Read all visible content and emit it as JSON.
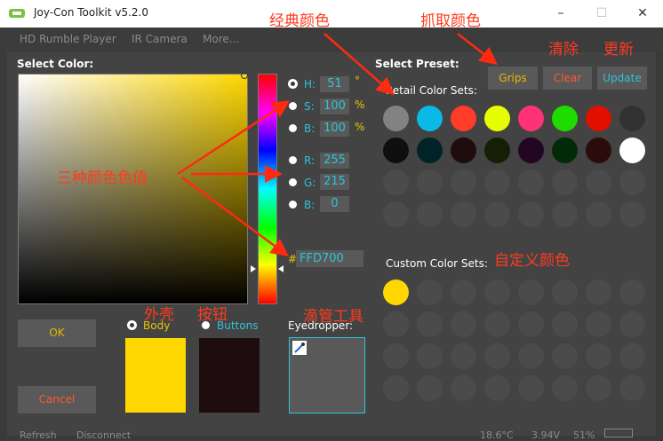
{
  "window": {
    "title": "Joy-Con Toolkit v5.2.0",
    "minimize": "–",
    "maximize": "☐",
    "close": "✕"
  },
  "menu": [
    "HD Rumble Player",
    "IR Camera",
    "More..."
  ],
  "select_color": "Select Color:",
  "hsb": [
    {
      "label": "H:",
      "value": "51",
      "unit": "°",
      "selected": true
    },
    {
      "label": "S:",
      "value": "100",
      "unit": "%"
    },
    {
      "label": "B:",
      "value": "100",
      "unit": "%"
    }
  ],
  "rgb": [
    {
      "label": "R:",
      "value": "255"
    },
    {
      "label": "G:",
      "value": "215"
    },
    {
      "label": "B:",
      "value": "0"
    }
  ],
  "hex": {
    "prefix": "#",
    "value": "FFD700"
  },
  "targets": {
    "body": "Body",
    "buttons": "Buttons",
    "body_color": "#ffd700",
    "buttons_color": "#1e0d0e"
  },
  "ok": "OK",
  "cancel": "Cancel",
  "eyedropper": "Eyedropper:",
  "select_preset": "Select Preset:",
  "buttons": {
    "grips": "Grips",
    "clear": "Clear",
    "update": "Update"
  },
  "retail_sets": "Retail Color Sets:",
  "custom_sets": "Custom Color Sets:",
  "retail_colors": [
    "#828282",
    "#0ab9e6",
    "#ff3c28",
    "#e6ff00",
    "#ff3278",
    "#1edc00",
    "#e10f00",
    "#323232",
    "#0f0f0f",
    "#012227",
    "#1f0c0c",
    "#161f06",
    "#230622",
    "#012a07",
    "#2a0d0b",
    "#ffffff"
  ],
  "custom_colors": [
    "#ffd700"
  ],
  "annotations": {
    "classic": "经典颜色",
    "grab": "抓取颜色",
    "clear": "清除",
    "update": "更新",
    "three_values": "三种颜色色值",
    "custom": "自定义颜色",
    "shell": "外壳",
    "button": "按钮",
    "dropper": "滴管工具"
  },
  "statusbar": {
    "refresh": "Refresh",
    "disconnect": "Disconnect",
    "temp": "18.6°C",
    "voltage": "3.94V",
    "battery": "51%"
  }
}
